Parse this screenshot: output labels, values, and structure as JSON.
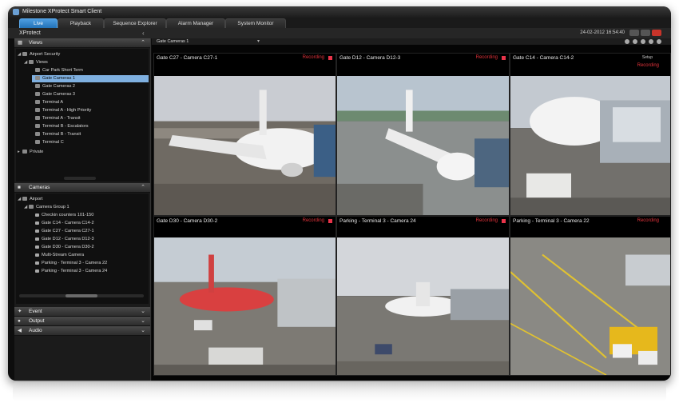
{
  "window": {
    "title": "Milestone XProtect Smart Client",
    "brand": "XProtect",
    "datetime": "24-02-2012 16:54:40"
  },
  "tabs": [
    {
      "label": "Live",
      "active": true
    },
    {
      "label": "Playback",
      "active": false
    },
    {
      "label": "Sequence Explorer",
      "active": false
    },
    {
      "label": "Alarm Manager",
      "active": false
    },
    {
      "label": "System Monitor",
      "active": false
    }
  ],
  "views_panel": {
    "title": "Views",
    "tree": [
      {
        "label": "Airport Security",
        "level": 0,
        "expanded": true,
        "type": "group"
      },
      {
        "label": "Views",
        "level": 1,
        "expanded": true,
        "type": "group"
      },
      {
        "label": "Car Park Short Term",
        "level": 2,
        "type": "view"
      },
      {
        "label": "Gate Cameras 1",
        "level": 2,
        "type": "view",
        "selected": true
      },
      {
        "label": "Gate Cameras 2",
        "level": 2,
        "type": "view"
      },
      {
        "label": "Gate Cameras 3",
        "level": 2,
        "type": "view"
      },
      {
        "label": "Terminal A",
        "level": 2,
        "type": "view"
      },
      {
        "label": "Terminal A - High Priority",
        "level": 2,
        "type": "view"
      },
      {
        "label": "Terminal A - Transit",
        "level": 2,
        "type": "view"
      },
      {
        "label": "Terminal B - Escalators",
        "level": 2,
        "type": "view"
      },
      {
        "label": "Terminal B - Transit",
        "level": 2,
        "type": "view"
      },
      {
        "label": "Terminal C",
        "level": 2,
        "type": "view"
      },
      {
        "label": "Private",
        "level": 0,
        "expanded": false,
        "type": "group"
      }
    ]
  },
  "cameras_panel": {
    "title": "Cameras",
    "tree": [
      {
        "label": "Airport",
        "level": 0,
        "expanded": true,
        "type": "group"
      },
      {
        "label": "Camera Group 1",
        "level": 1,
        "expanded": true,
        "type": "group"
      },
      {
        "label": "Checkin counters 101-150",
        "level": 2,
        "type": "camera"
      },
      {
        "label": "Gate C14 - Camera C14-2",
        "level": 2,
        "type": "camera"
      },
      {
        "label": "Gate C27 - Camera C27-1",
        "level": 2,
        "type": "camera"
      },
      {
        "label": "Gate D12 - Camera D12-3",
        "level": 2,
        "type": "camera"
      },
      {
        "label": "Gate D30 - Camera D30-2",
        "level": 2,
        "type": "camera"
      },
      {
        "label": "Multi-Stream Camera",
        "level": 2,
        "type": "camera"
      },
      {
        "label": "Parking - Terminal 3 - Camera 22",
        "level": 2,
        "type": "camera"
      },
      {
        "label": "Parking - Terminal 3 - Camera 24",
        "level": 2,
        "type": "camera"
      }
    ]
  },
  "collapsed_panels": [
    {
      "title": "Event"
    },
    {
      "title": "Output"
    },
    {
      "title": "Audio"
    }
  ],
  "view_bar": {
    "current_view": "Gate Cameras 1",
    "setup_label": "Setup"
  },
  "tiles": [
    {
      "title": "Gate C27 - Camera C27-1",
      "status": "Recording"
    },
    {
      "title": "Gate D12 - Camera D12-3",
      "status": "Recording"
    },
    {
      "title": "Gate C14 - Camera C14-2",
      "status": "Recording"
    },
    {
      "title": "Gate D30 - Camera D30-2",
      "status": "Recording"
    },
    {
      "title": "Parking - Terminal 3 - Camera 24",
      "status": "Recording"
    },
    {
      "title": "Parking - Terminal 3 - Camera 22",
      "status": "Recording"
    }
  ],
  "colors": {
    "accent": "#2f86d0",
    "recording": "#e0323a",
    "selection": "#7fb0e0"
  }
}
